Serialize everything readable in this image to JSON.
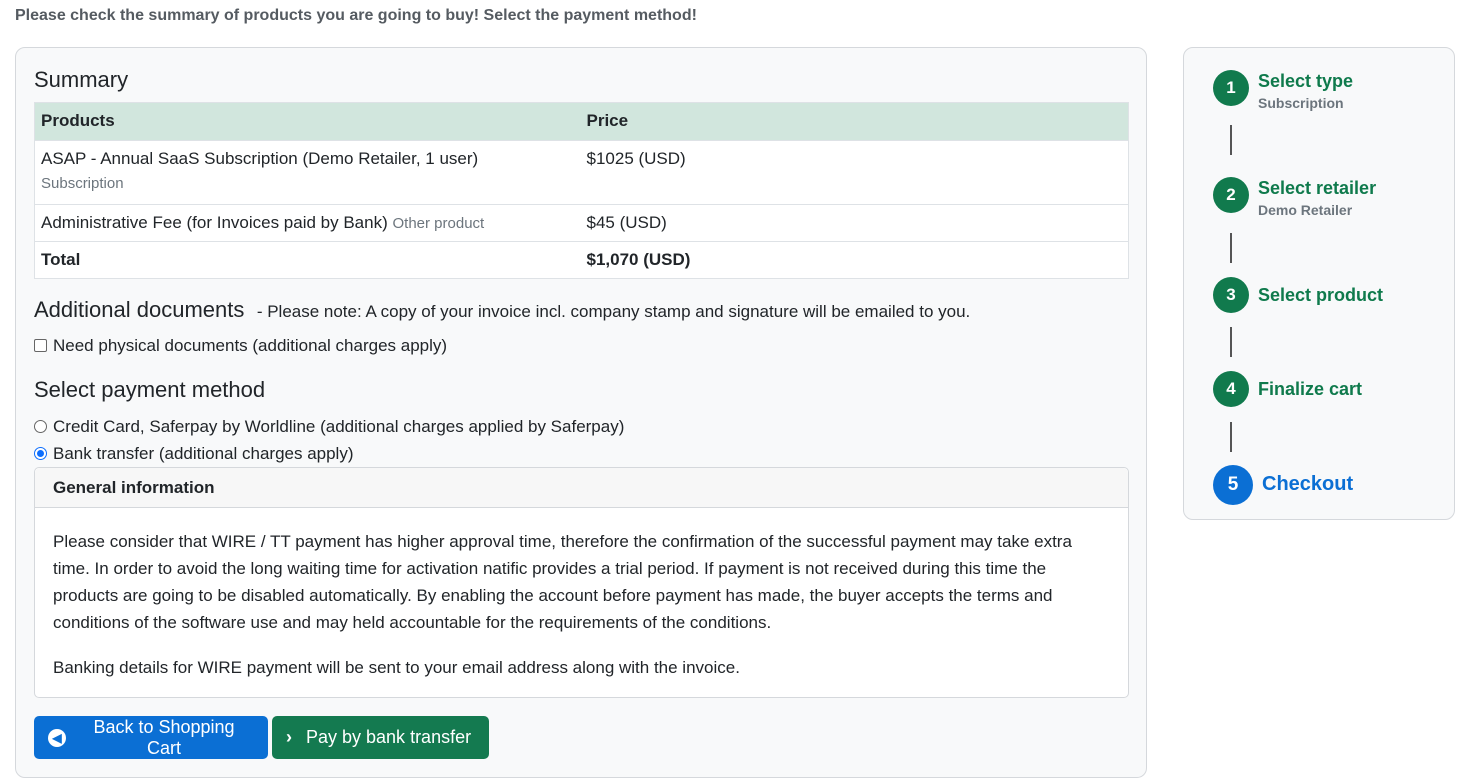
{
  "intro": "Please check the summary of products you are going to buy! Select the payment method!",
  "summary": {
    "title": "Summary",
    "headers": {
      "products": "Products",
      "price": "Price"
    },
    "rows": [
      {
        "product": "ASAP - Annual SaaS Subscription (Demo Retailer, 1 user)",
        "type": "Subscription",
        "price": "$1025 (USD)"
      },
      {
        "product": "Administrative Fee (for Invoices paid by Bank)",
        "type": "Other product",
        "price": "$45 (USD)"
      }
    ],
    "total_label": "Total",
    "total_value": "$1,070 (USD)"
  },
  "documents": {
    "title": "Additional documents",
    "note": "- Please note: A copy of your invoice incl. company stamp and signature will be emailed to you.",
    "checkbox_label": "Need physical documents (additional charges apply)",
    "checkbox_checked": false
  },
  "payment": {
    "title": "Select payment method",
    "options": [
      {
        "label": "Credit Card, Saferpay by Worldline (additional charges applied by Saferpay)",
        "checked": false
      },
      {
        "label": "Bank transfer (additional charges apply)",
        "checked": true
      }
    ]
  },
  "info": {
    "header": "General information",
    "paragraph1": "Please consider that WIRE / TT payment has higher approval time, therefore the confirmation of the successful payment may take extra time. In order to avoid the long waiting time for activation natific provides a trial period. If payment is not received during this time the products are going to be disabled automatically. By enabling the account before payment has made, the buyer accepts the terms and conditions of the software use and may held accountable for the requirements of the conditions.",
    "paragraph2": "Banking details for WIRE payment will be sent to your email address along with the invoice."
  },
  "buttons": {
    "back": "Back to Shopping Cart",
    "pay": "Pay by bank transfer"
  },
  "steps": [
    {
      "number": "1",
      "title": "Select type",
      "subtitle": "Subscription"
    },
    {
      "number": "2",
      "title": "Select retailer",
      "subtitle": "Demo Retailer"
    },
    {
      "number": "3",
      "title": "Select product",
      "subtitle": ""
    },
    {
      "number": "4",
      "title": "Finalize cart",
      "subtitle": ""
    },
    {
      "number": "5",
      "title": "Checkout",
      "subtitle": ""
    }
  ],
  "colors": {
    "primary": "#0b6fd4",
    "success": "#117a4d",
    "table_header": "#d1e6dd"
  }
}
